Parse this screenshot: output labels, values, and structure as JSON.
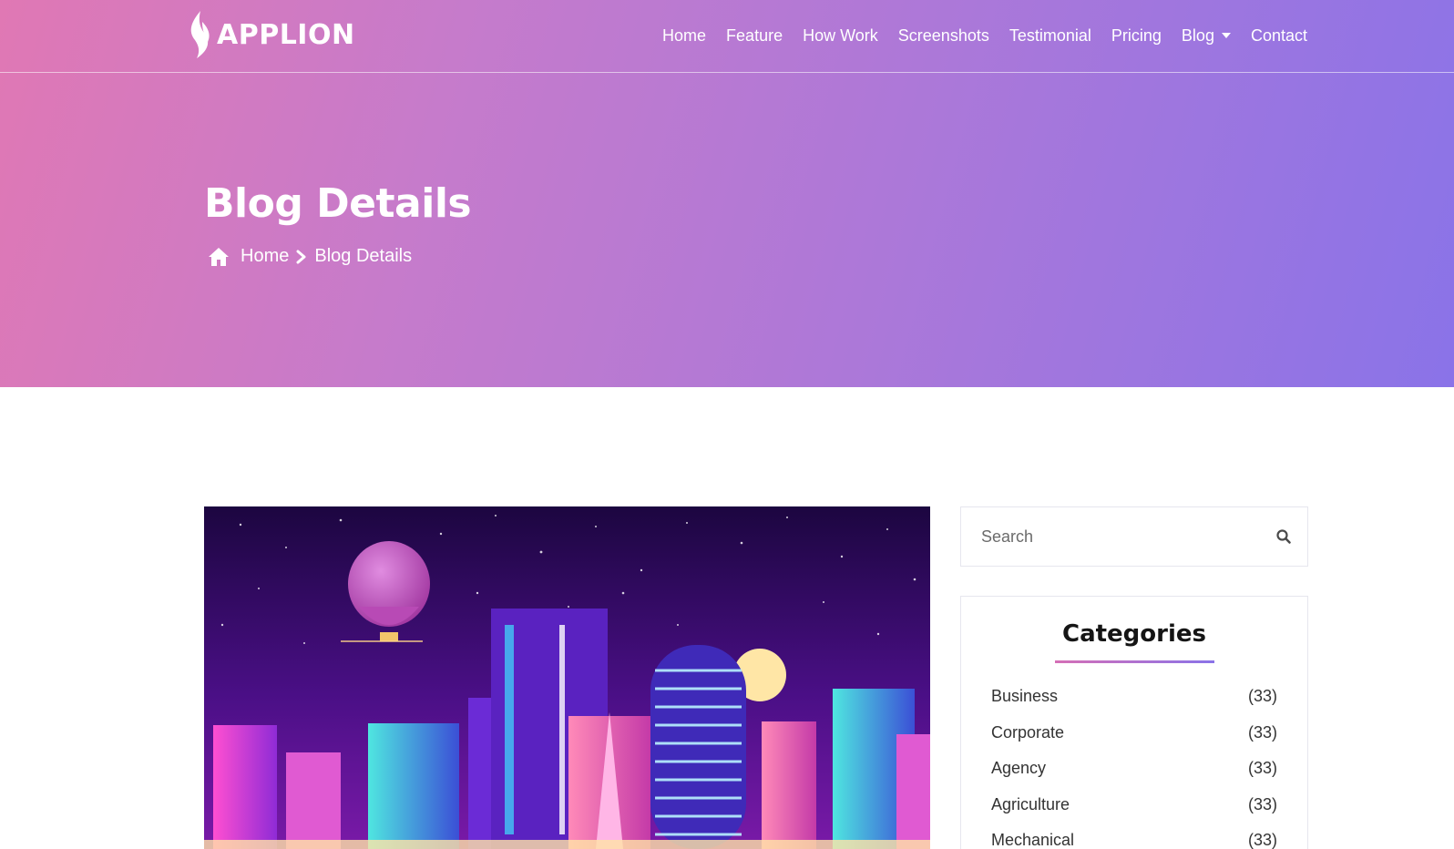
{
  "brand": {
    "name": "APPLION",
    "icon": "flame-leaf-logo-icon"
  },
  "nav": {
    "items": [
      {
        "label": "Home"
      },
      {
        "label": "Feature"
      },
      {
        "label": "How Work"
      },
      {
        "label": "Screenshots"
      },
      {
        "label": "Testimonial"
      },
      {
        "label": "Pricing"
      },
      {
        "label": "Blog",
        "dropdown": true
      },
      {
        "label": "Contact"
      }
    ]
  },
  "hero": {
    "title": "Blog Details",
    "breadcrumb": {
      "home": "Home",
      "current": "Blog Details",
      "home_icon": "home-icon",
      "separator_icon": "chevron-right-icon"
    }
  },
  "post": {
    "image": "neon city skyline illustration with hot air balloon"
  },
  "sidebar": {
    "search": {
      "placeholder": "Search",
      "icon": "search-icon"
    },
    "categories": {
      "title": "Categories",
      "items": [
        {
          "label": "Business",
          "count": "(33)"
        },
        {
          "label": "Corporate",
          "count": "(33)"
        },
        {
          "label": "Agency",
          "count": "(33)"
        },
        {
          "label": "Agriculture",
          "count": "(33)"
        },
        {
          "label": "Mechanical",
          "count": "(33)"
        }
      ]
    }
  },
  "colors": {
    "gradient_start": "#e078b4",
    "gradient_end": "#8a73e8",
    "accent": "#8a73e8"
  }
}
